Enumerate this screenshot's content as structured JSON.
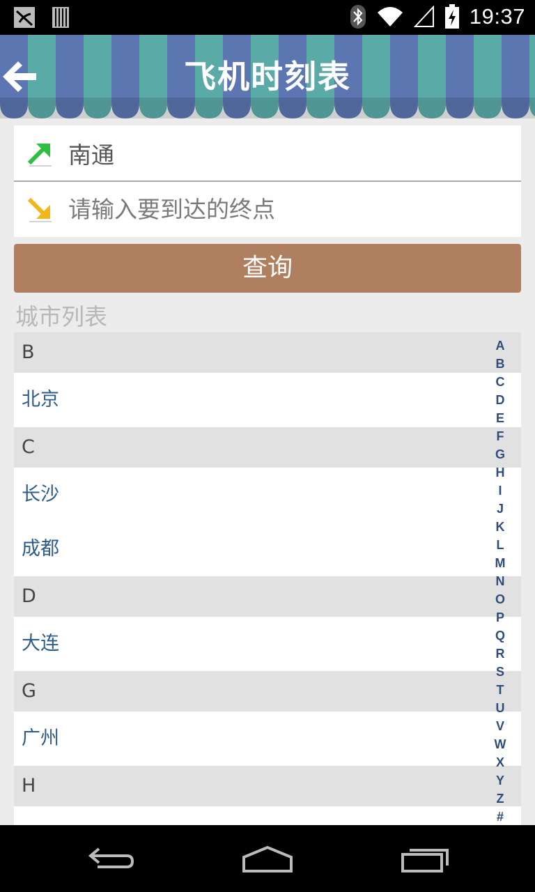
{
  "status_bar": {
    "time": "19:37",
    "icons": [
      "notification-icon",
      "sim-icon",
      "bluetooth-icon",
      "wifi-icon",
      "signal-icon",
      "battery-icon"
    ]
  },
  "header": {
    "title": "飞机时刻表",
    "back_icon": "back-arrow-icon",
    "colors": {
      "stripe_blue": "#5b76b0",
      "stripe_teal": "#5aaaa8"
    }
  },
  "search": {
    "from_value": "南通",
    "to_placeholder": "请输入要到达的终点",
    "from_icon": "departure-arrow-icon",
    "to_icon": "arrival-arrow-icon",
    "query_label": "查询",
    "query_color": "#b07f5f"
  },
  "city_list": {
    "label": "城市列表",
    "groups": [
      {
        "letter": "B",
        "cities": [
          "北京"
        ]
      },
      {
        "letter": "C",
        "cities": [
          "长沙",
          "成都"
        ]
      },
      {
        "letter": "D",
        "cities": [
          "大连"
        ]
      },
      {
        "letter": "G",
        "cities": [
          "广州"
        ]
      },
      {
        "letter": "H",
        "cities": []
      }
    ]
  },
  "alpha_index": [
    "A",
    "B",
    "C",
    "D",
    "E",
    "F",
    "G",
    "H",
    "I",
    "J",
    "K",
    "L",
    "M",
    "N",
    "O",
    "P",
    "Q",
    "R",
    "S",
    "T",
    "U",
    "V",
    "W",
    "X",
    "Y",
    "Z",
    "#"
  ],
  "nav_bar": {
    "icons": [
      "back-icon",
      "home-icon",
      "recent-apps-icon"
    ]
  }
}
